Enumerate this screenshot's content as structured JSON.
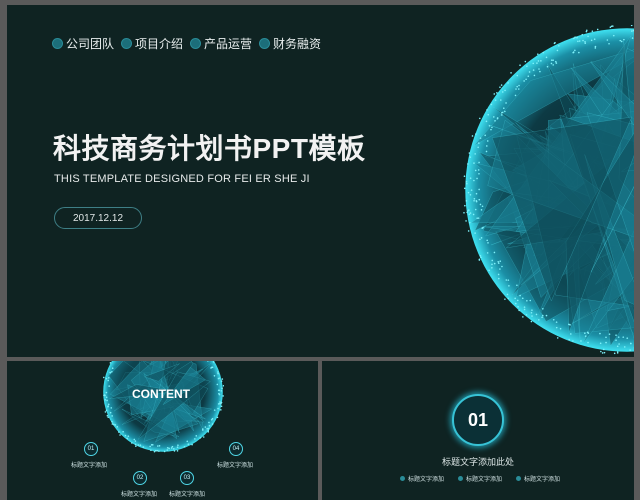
{
  "main": {
    "nav": [
      "公司团队",
      "项目介绍",
      "产品运营",
      "财务融资"
    ],
    "title": "科技商务计划书PPT模板",
    "subtitle": "THIS TEMPLATE DESIGNED FOR FEI ER SHE JI",
    "date": "2017.12.12"
  },
  "thumb_content": {
    "title": "CONTENT",
    "items": [
      {
        "num": "01",
        "label": "标题文字添加"
      },
      {
        "num": "02",
        "label": "标题文字添加"
      },
      {
        "num": "03",
        "label": "标题文字添加"
      },
      {
        "num": "04",
        "label": "标题文字添加"
      }
    ]
  },
  "thumb_section": {
    "number": "01",
    "title": "标题文字添加此处",
    "items": [
      "标题文字添加",
      "标题文字添加",
      "标题文字添加"
    ]
  },
  "colors": {
    "background": "#0f2322",
    "accent": "#3fd4e6",
    "text": "#f2f2f2"
  }
}
